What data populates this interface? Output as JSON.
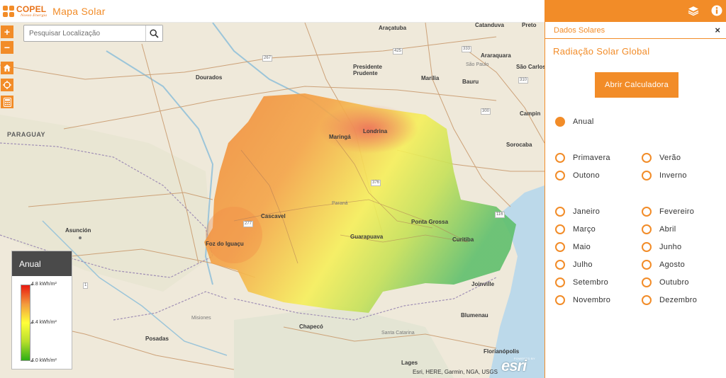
{
  "header": {
    "logo_name": "COPEL",
    "logo_sub": "Nosso Energia",
    "app_title": "Mapa Solar"
  },
  "search": {
    "placeholder": "Pesquisar Localização"
  },
  "tools": {
    "zoom_in": "+",
    "zoom_out": "−"
  },
  "map": {
    "labels": {
      "paraguay": "PARAGUAY",
      "asuncion": "Asunción",
      "foz": "Foz do Iguaçu",
      "cascavel": "Cascavel",
      "maringa": "Maringá",
      "londrina": "Londrina",
      "parana": "Paraná",
      "ponta_grossa": "Ponta Grossa",
      "guarapuava": "Guarapuava",
      "curitiba": "Curitiba",
      "joinville": "Joinville",
      "blumenau": "Blumenau",
      "chapeco": "Chapecó",
      "santa_catarina": "Santa Catarina",
      "lages": "Lages",
      "florianopolis": "Florianópolis",
      "posadas": "Posadas",
      "misiones": "Misiones",
      "dourados": "Dourados",
      "presidente_prudente": "Presidente Prudente",
      "aracatuba": "Araçatuba",
      "marilia": "Marília",
      "bauru": "Bauru",
      "sao_paulo": "São Paulo",
      "araraquara": "Araraquara",
      "sao_carlos": "São Carlos",
      "catanduva": "Catanduva",
      "preto": "Preto",
      "campinas": "Campin",
      "sorocaba": "Sorocaba"
    },
    "roads": {
      "r267": "267",
      "r425": "425",
      "r333": "333",
      "r310": "310",
      "r300": "300",
      "r376": "376",
      "r277": "277",
      "r116": "116",
      "r1": "1"
    },
    "attribution": "Esri, HERE, Garmin, NGA, USGS",
    "esri_powered": "POWERED BY",
    "esri_word": "esri"
  },
  "legend": {
    "title": "Anual",
    "max": "4.8 kWh/m²",
    "mid": "4.4 kWh/m²",
    "min": "4.0 kWh/m²",
    "colors": {
      "high": "#e8190f",
      "mid": "#ffff3a",
      "low": "#2eae14"
    }
  },
  "panel": {
    "header_title": "Dados Solares",
    "close": "×",
    "subtitle": "Radiação Solar Global",
    "calc_button": "Abrir Calculadora",
    "annual": "Anual",
    "seasons": [
      "Primavera",
      "Verão",
      "Outono",
      "Inverno"
    ],
    "months": [
      "Janeiro",
      "Fevereiro",
      "Março",
      "Abril",
      "Maio",
      "Junho",
      "Julho",
      "Agosto",
      "Setembro",
      "Outubro",
      "Novembro",
      "Dezembro"
    ],
    "selected": "Anual"
  },
  "colors": {
    "accent": "#f28c28"
  }
}
